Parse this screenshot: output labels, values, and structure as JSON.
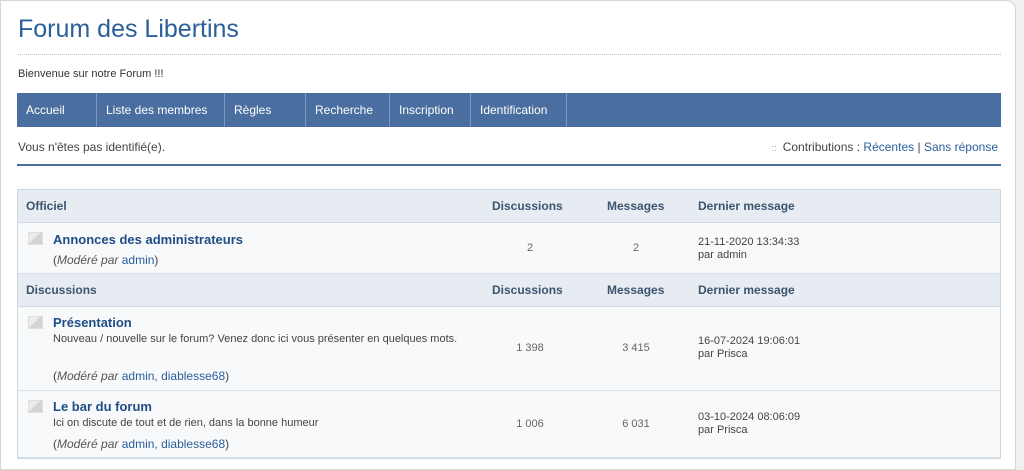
{
  "header": {
    "title": "Forum des Libertins",
    "welcome": "Bienvenue sur notre Forum !!!"
  },
  "nav": [
    {
      "label": "Accueil"
    },
    {
      "label": "Liste des membres"
    },
    {
      "label": "Règles"
    },
    {
      "label": "Recherche"
    },
    {
      "label": "Inscription"
    },
    {
      "label": "Identification"
    }
  ],
  "status": {
    "not_logged": "Vous n'êtes pas identifié(e).",
    "bullet": "::",
    "contributions_label": "Contributions :",
    "recent": "Récentes",
    "separator": "|",
    "unanswered": "Sans réponse"
  },
  "categories": [
    {
      "name": "Officiel",
      "col_discussions": "Discussions",
      "col_messages": "Messages",
      "col_last": "Dernier message",
      "forums": [
        {
          "name": "Annonces des administrateurs",
          "description": "",
          "moderated_open": "(",
          "moderated_label": "Modéré par",
          "moderators": "admin",
          "moderated_close": ")",
          "discussions": "2",
          "messages": "2",
          "last_date": "21-11-2020 13:34:33",
          "last_by": "par admin"
        }
      ]
    },
    {
      "name": "Discussions",
      "col_discussions": "Discussions",
      "col_messages": "Messages",
      "col_last": "Dernier message",
      "forums": [
        {
          "name": "Présentation",
          "description": "Nouveau / nouvelle sur le forum? Venez donc ici vous présenter en quelques mots.",
          "moderated_open": "(",
          "moderated_label": "Modéré par",
          "moderators": "admin, diablesse68",
          "moderated_close": ")",
          "discussions": "1 398",
          "messages": "3 415",
          "last_date": "16-07-2024 19:06:01",
          "last_by": "par Prisca"
        },
        {
          "name": "Le bar du forum",
          "description": "Ici on discute de tout et de rien, dans la bonne humeur",
          "moderated_open": "(",
          "moderated_label": "Modéré par",
          "moderators": "admin, diablesse68",
          "moderated_close": ")",
          "discussions": "1 006",
          "messages": "6 031",
          "last_date": "03-10-2024 08:06:09",
          "last_by": "par Prisca"
        }
      ]
    }
  ]
}
